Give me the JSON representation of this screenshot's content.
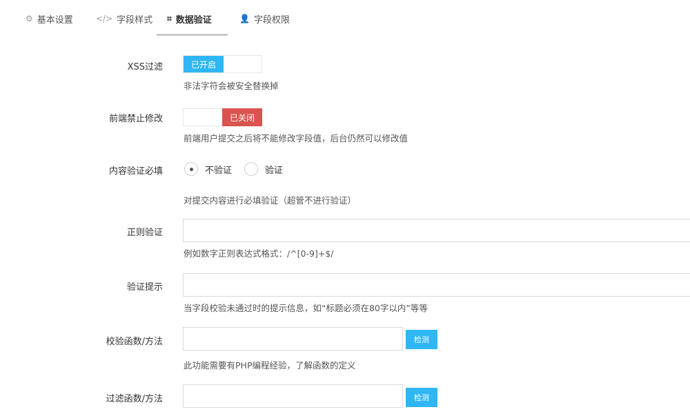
{
  "tabs": [
    {
      "icon": "gear-icon",
      "glyph": "⚙",
      "label": "基本设置"
    },
    {
      "icon": "code-icon",
      "glyph": "</>",
      "label": "字段样式"
    },
    {
      "icon": "crop-icon",
      "glyph": "⌗",
      "label": "数据验证"
    },
    {
      "icon": "user-icon",
      "glyph": "👤",
      "label": "字段权限"
    }
  ],
  "active_tab": "数据验证",
  "xss_filter": {
    "label": "XSS过滤",
    "state": "已开启",
    "help": "非法字符会被安全替换掉"
  },
  "frontend_lock": {
    "label": "前端禁止修改",
    "state": "已关闭",
    "help": "前端用户提交之后将不能修改字段值，后台仍然可以修改值"
  },
  "required": {
    "label": "内容验证必填",
    "options": [
      "不验证",
      "验证"
    ],
    "selected": "不验证",
    "help": "对提交内容进行必填验证（超管不进行验证）"
  },
  "regex": {
    "label": "正则验证",
    "value": "",
    "help": "例如数字正则表达式格式：/^[0-9]+$/"
  },
  "hint": {
    "label": "验证提示",
    "value": "",
    "help": "当字段校验未通过时的提示信息，如“标题必须在80字以内”等等"
  },
  "check_func": {
    "label": "校验函数/方法",
    "value": "",
    "button": "检测",
    "help": "此功能需要有PHP编程经验，了解函数的定义"
  },
  "filter_func": {
    "label": "过滤函数/方法",
    "value": "",
    "button": "检测"
  },
  "colors": {
    "accent": "#2fb6f4",
    "danger": "#d9534f"
  }
}
